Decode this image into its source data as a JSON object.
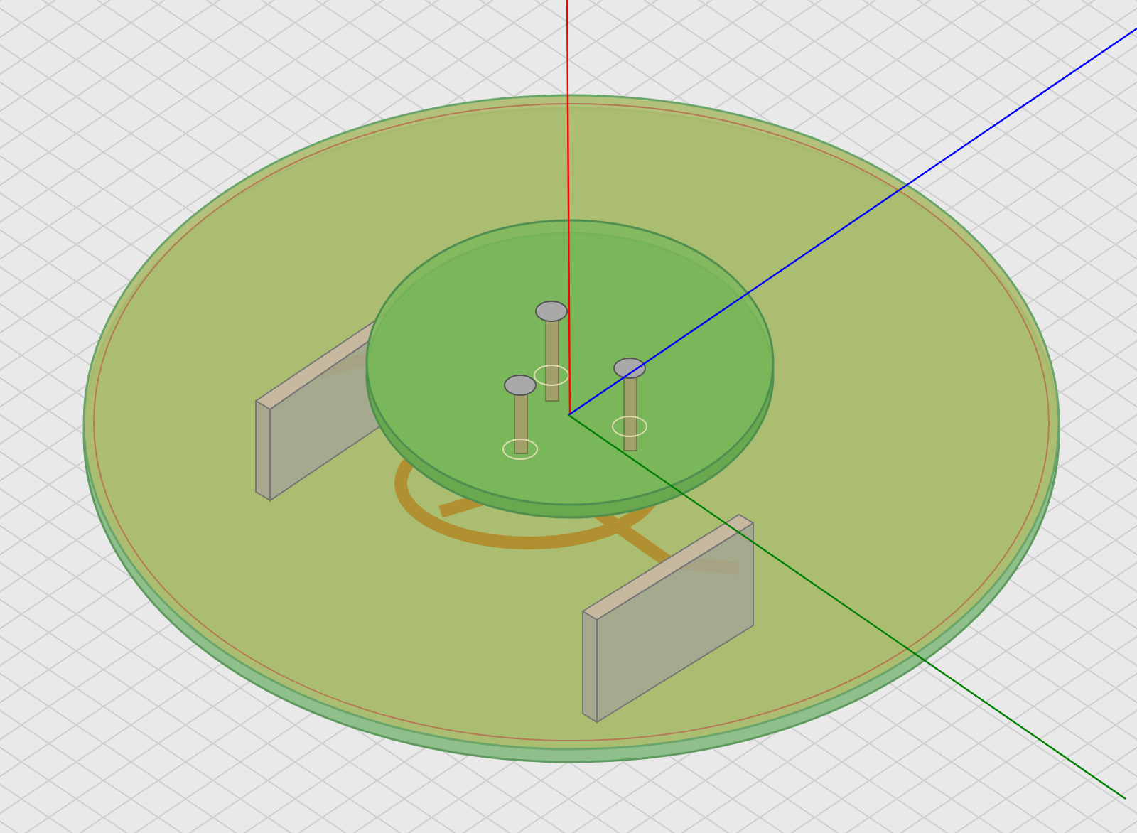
{
  "axes": [
    {
      "color": "#ff0000"
    },
    {
      "color": "#0000ff"
    },
    {
      "color": "#008000"
    }
  ]
}
